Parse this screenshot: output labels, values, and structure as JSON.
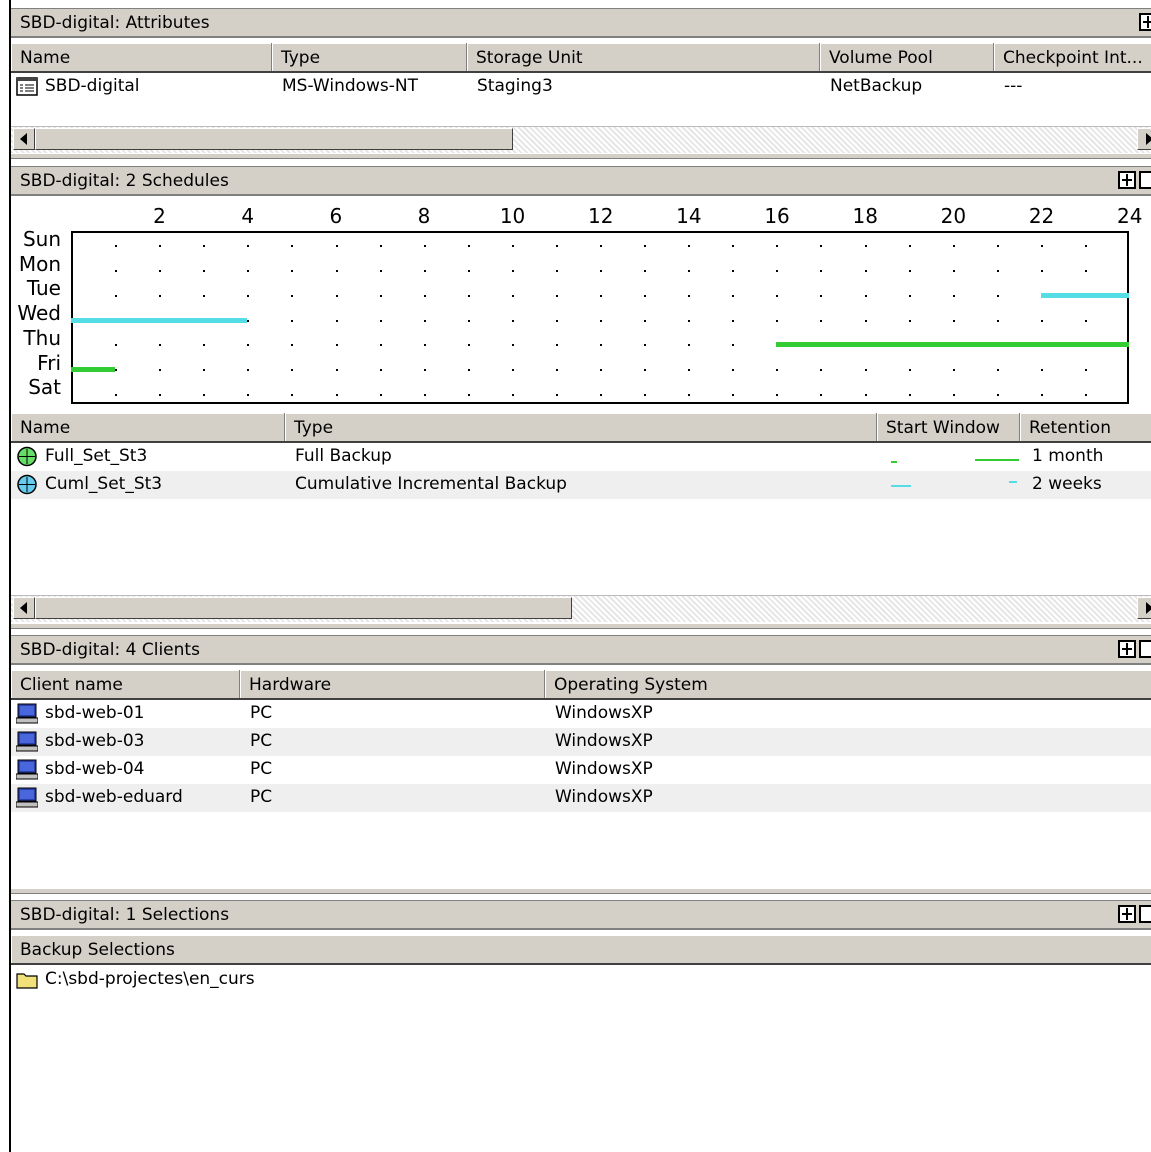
{
  "colors": {
    "panel": "#d4d0c8",
    "cumulative": "#55dde6",
    "full": "#33cc33"
  },
  "attributes": {
    "title": "SBD-digital: Attributes",
    "columns": [
      "Name",
      "Type",
      "Storage Unit",
      "Volume Pool",
      "Checkpoint Int..."
    ],
    "row": {
      "icon": "policy-icon",
      "name": "SBD-digital",
      "type": "MS-Windows-NT",
      "storage": "Staging3",
      "pool": "NetBackup",
      "checkpoint": "---"
    }
  },
  "schedules": {
    "title": "SBD-digital: 2 Schedules",
    "columns": [
      "Name",
      "Type",
      "Start Window",
      "Retention"
    ],
    "rows": [
      {
        "icon": "clock-icon",
        "name": "Full_Set_St3",
        "type": "Full Backup",
        "retention": "1 month",
        "color": "#33cc33"
      },
      {
        "icon": "clock-icon",
        "name": "Cuml_Set_St3",
        "type": "Cumulative Incremental Backup",
        "retention": "2 weeks",
        "color": "#55dde6"
      }
    ]
  },
  "chart_data": {
    "type": "schedule-grid",
    "hours": [
      "2",
      "4",
      "6",
      "8",
      "10",
      "12",
      "14",
      "16",
      "18",
      "20",
      "22",
      "24"
    ],
    "days": [
      "Sun",
      "Mon",
      "Tue",
      "Wed",
      "Thu",
      "Fri",
      "Sat"
    ],
    "windows": [
      {
        "schedule": "Cuml_Set_St3",
        "day": "Tue",
        "start": 22,
        "end": 24
      },
      {
        "schedule": "Cuml_Set_St3",
        "day": "Wed",
        "start": 0,
        "end": 4
      },
      {
        "schedule": "Full_Set_St3",
        "day": "Thu",
        "start": 16,
        "end": 24
      },
      {
        "schedule": "Full_Set_St3",
        "day": "Fri",
        "start": 0,
        "end": 1
      }
    ]
  },
  "clients": {
    "title": "SBD-digital: 4 Clients",
    "columns": [
      "Client name",
      "Hardware",
      "Operating System"
    ],
    "rows": [
      {
        "name": "sbd-web-01",
        "hw": "PC",
        "os": "WindowsXP"
      },
      {
        "name": "sbd-web-03",
        "hw": "PC",
        "os": "WindowsXP"
      },
      {
        "name": "sbd-web-04",
        "hw": "PC",
        "os": "WindowsXP"
      },
      {
        "name": "sbd-web-eduard",
        "hw": "PC",
        "os": "WindowsXP"
      }
    ]
  },
  "selections": {
    "title": "SBD-digital: 1 Selections",
    "column": "Backup Selections",
    "items": [
      {
        "icon": "folder-icon",
        "path": "C:\\sbd-projectes\\en_curs"
      }
    ]
  }
}
